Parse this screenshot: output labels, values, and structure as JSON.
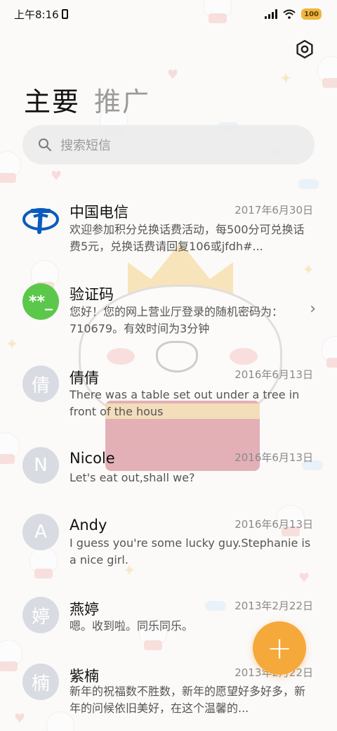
{
  "status_bar": {
    "time": "上午8:16",
    "battery": "100"
  },
  "tabs": [
    {
      "label": "主要",
      "active": true
    },
    {
      "label": "推广",
      "active": false
    }
  ],
  "search": {
    "placeholder": "搜索短信"
  },
  "conversations": [
    {
      "name": "中国电信",
      "date": "2017年6月30日",
      "preview": "欢迎参加积分兑换话费活动，每500分可兑换话费5元，兑换话费请回复106或jfdh#...",
      "avatar": "telecom-logo"
    },
    {
      "name": "验证码",
      "date": "",
      "preview": "您好！您的网上营业厅登录的随机密码为：710679。有效时间为3分钟",
      "avatar_text": "**_"
    },
    {
      "name": "倩倩",
      "date": "2016年6月13日",
      "preview": "There was a table set out under a tree in front of the hous",
      "avatar_text": "倩"
    },
    {
      "name": "Nicole",
      "date": "2016年6月13日",
      "preview": "Let's eat out,shall we?",
      "avatar_text": "N"
    },
    {
      "name": "Andy",
      "date": "2016年6月13日",
      "preview": "I guess you're some lucky guy.Stephanie is a nice girl.",
      "avatar_text": "A"
    },
    {
      "name": "燕婷",
      "date": "2013年2月22日",
      "preview": "嗯。收到啦。同乐同乐。",
      "avatar_text": "婷"
    },
    {
      "name": "紫楠",
      "date": "2013年2月22日",
      "preview": "新年的祝福数不胜数，新年的愿望好多好多，新年的问候依旧美好，在这个温馨的...",
      "avatar_text": "楠"
    }
  ],
  "fab": {
    "label": "+"
  },
  "colors": {
    "accent": "#f6a93b",
    "verify_green": "#5cc84b",
    "telecom_blue": "#0a5bbd"
  }
}
